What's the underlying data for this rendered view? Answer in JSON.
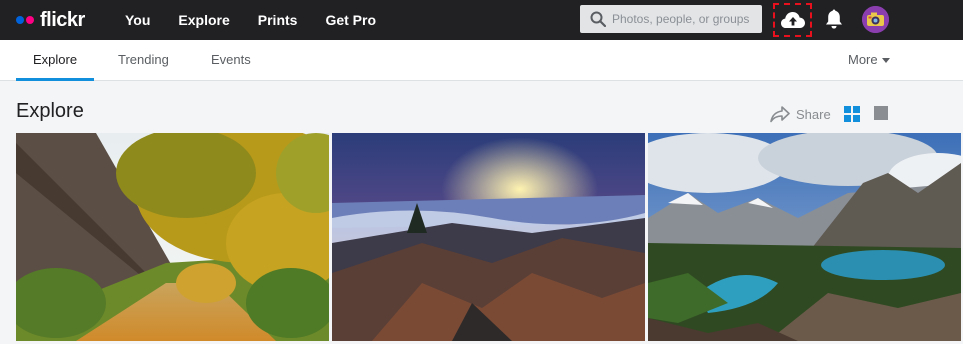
{
  "header": {
    "logo_text": "flickr",
    "nav": [
      "You",
      "Explore",
      "Prints",
      "Get Pro"
    ],
    "search_placeholder": "Photos, people, or groups",
    "upload_icon": "cloud-upload-icon",
    "notifications_icon": "bell-icon",
    "avatar_icon": "avatar"
  },
  "subnav": {
    "tabs": [
      "Explore",
      "Trending",
      "Events"
    ],
    "active_tab": "Explore",
    "more_label": "More"
  },
  "content": {
    "title": "Explore",
    "share_label": "Share",
    "view_icons": [
      "grid-view-icon",
      "single-view-icon"
    ]
  },
  "photos": [
    {
      "subject": "autumn-path",
      "icon": "photo-thumbnail"
    },
    {
      "subject": "mountain-sunset",
      "icon": "photo-thumbnail"
    },
    {
      "subject": "mountain-lake",
      "icon": "photo-thumbnail"
    }
  ],
  "colors": {
    "topbar": "#212124",
    "accent_blue": "#0063dc",
    "accent_pink": "#ff0084",
    "tab_underline": "#128fdc",
    "highlight_red": "#e8101d"
  }
}
